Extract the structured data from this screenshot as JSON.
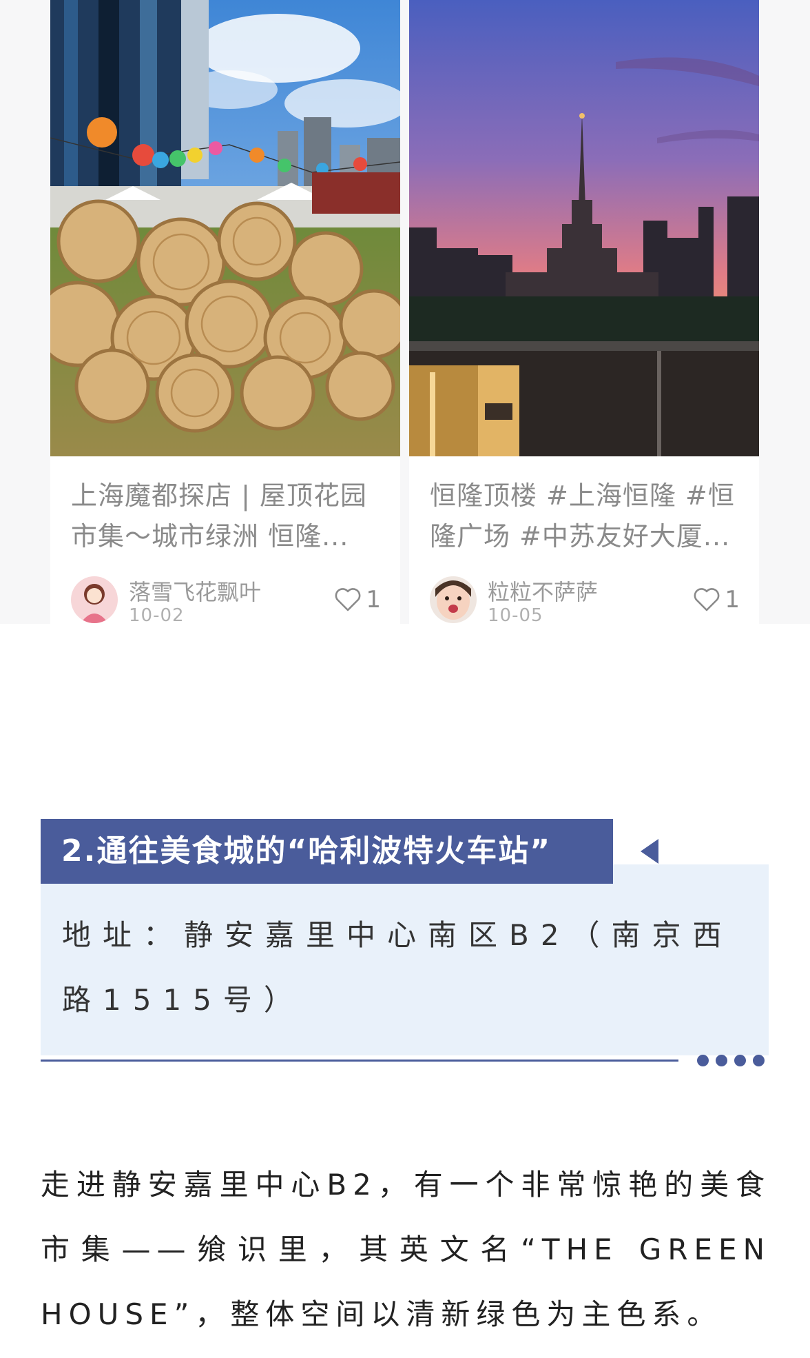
{
  "posts": [
    {
      "title": "上海魔都探店 | 屋顶花园市集～城市绿洲 恒隆...",
      "author": "落雪飞花飘叶",
      "date": "10-02",
      "likes": "1",
      "image": "rooftop-market-rattan-spheres"
    },
    {
      "title": "恒隆顶楼 #上海恒隆  #恒隆广场  #中苏友好大厦...",
      "author": "粒粒不萨萨",
      "date": "10-05",
      "likes": "1",
      "image": "sunset-exhibition-center-skyline"
    }
  ],
  "section": {
    "title": "2.通往美食城的“哈利波特火车站”",
    "address": "地址：静安嘉里中心南区B2（南京西路1515号）"
  },
  "body": {
    "paragraph": "走进静安嘉里中心B2，有一个非常惊艳的美食市集——飨识里，其英文名“THE GREEN HOUSE”，整体空间以清新绿色为主色系。"
  },
  "colors": {
    "accent": "#4a5c9b",
    "section_bg": "#e9f1fa",
    "muted_text": "#8a8a8a"
  }
}
